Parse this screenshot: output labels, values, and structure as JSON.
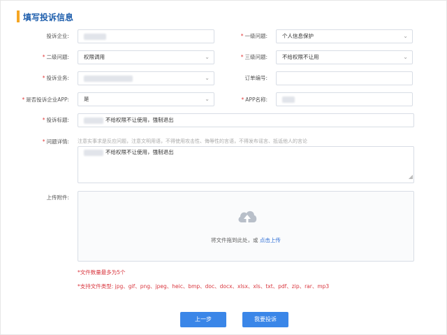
{
  "section": {
    "title": "填写投诉信息"
  },
  "form": {
    "row1": {
      "company_label": "投诉企业:",
      "company_value": "",
      "level1_label": "一级问题:",
      "level1_value": "个人信息保护"
    },
    "row2": {
      "level2_label": "二级问题:",
      "level2_value": "权限调用",
      "level3_label": "三级问题:",
      "level3_value": "不给权限不让用"
    },
    "row3": {
      "business_label": "投诉业务:",
      "business_value": "",
      "order_label": "订单编号:",
      "order_value": ""
    },
    "row4": {
      "is_app_label": "是否投诉企业APP:",
      "is_app_value": "是",
      "app_name_label": "APP名称:",
      "app_name_value": ""
    },
    "complaint_title": {
      "label": "投诉标题:",
      "value": "不给权限不让使用，强制退出"
    },
    "detail": {
      "label": "问题详情:",
      "hint": "注意实事求是反应问题，注意文明用语，不得使用攻击性、侮辱性的言语，不得发布谣言、抵诋他人的言论",
      "value": "不给权限不让使用，强制退出"
    },
    "attachment": {
      "label": "上传附件:",
      "drop_text": "将文件拖到此处，或",
      "click_text": "点击上传"
    },
    "notes": {
      "max_files": "*文件数量最多为5个",
      "file_types": "*支持文件类型: jpg、gif、png、jpeg、heic、bmp、doc、docx、xlsx、xls、txt、pdf、zip、rar、mp3"
    }
  },
  "buttons": {
    "prev": "上一步",
    "submit": "我要投诉"
  },
  "required_mark": "*",
  "colors": {
    "title": "#1f5fad",
    "accent_bar": "#f5a623",
    "button": "#3a86e8",
    "link": "#2f6fd6",
    "note": "#d9363e"
  },
  "icons": {
    "upload": "cloud-upload-icon",
    "dropdown": "chevron-down-icon"
  }
}
